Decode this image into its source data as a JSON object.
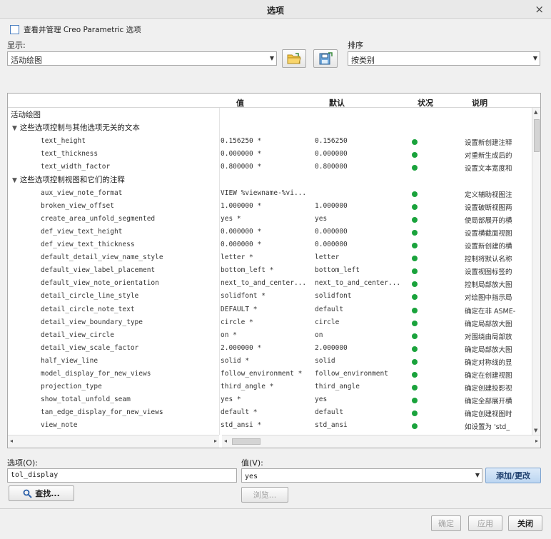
{
  "window": {
    "title": "选项",
    "close_glyph": "×"
  },
  "manage_checkbox": {
    "label": "查看并管理 Creo Parametric 选项",
    "checked": false
  },
  "display": {
    "label": "显示:",
    "value": "活动绘图"
  },
  "sort": {
    "label": "排序",
    "value": "按类别"
  },
  "table": {
    "headers": {
      "value": "值",
      "default": "默认",
      "status": "状况",
      "description": "说明"
    },
    "root_label": "活动绘图",
    "groups": [
      {
        "label": "这些选项控制与其他选项无关的文本",
        "rows": [
          {
            "name": "text_height",
            "value": "0.156250 *",
            "default": "0.156250",
            "desc": "设置新创建注释"
          },
          {
            "name": "text_thickness",
            "value": "0.000000 *",
            "default": "0.000000",
            "desc": "对重新生成后的"
          },
          {
            "name": "text_width_factor",
            "value": "0.800000 *",
            "default": "0.800000",
            "desc": "设置文本宽度和"
          }
        ]
      },
      {
        "label": "这些选项控制视图和它们的注释",
        "rows": [
          {
            "name": "aux_view_note_format",
            "value": "VIEW %viewname-%vi...",
            "default": "",
            "desc": "定义辅助视图注"
          },
          {
            "name": "broken_view_offset",
            "value": "1.000000 *",
            "default": "1.000000",
            "desc": "设置破断视图两"
          },
          {
            "name": "create_area_unfold_segmented",
            "value": "yes *",
            "default": "yes",
            "desc": "使局部展开的横"
          },
          {
            "name": "def_view_text_height",
            "value": "0.000000 *",
            "default": "0.000000",
            "desc": "设置横截面视图"
          },
          {
            "name": "def_view_text_thickness",
            "value": "0.000000 *",
            "default": "0.000000",
            "desc": "设置新创建的横"
          },
          {
            "name": "default_detail_view_name_style",
            "value": "letter *",
            "default": "letter",
            "desc": "控制将默认名称"
          },
          {
            "name": "default_view_label_placement",
            "value": "bottom_left *",
            "default": "bottom_left",
            "desc": "设置视图标签的"
          },
          {
            "name": "default_view_note_orientation",
            "value": "next_to_and_center...",
            "default": "next_to_and_center...",
            "desc": "控制局部放大图"
          },
          {
            "name": "detail_circle_line_style",
            "value": "solidfont *",
            "default": "solidfont",
            "desc": "对绘图中指示局"
          },
          {
            "name": "detail_circle_note_text",
            "value": "DEFAULT *",
            "default": "default",
            "desc": "确定在非 ASME-"
          },
          {
            "name": "detail_view_boundary_type",
            "value": "circle *",
            "default": "circle",
            "desc": "确定局部放大图"
          },
          {
            "name": "detail_view_circle",
            "value": "on *",
            "default": "on",
            "desc": "对围绕由局部放"
          },
          {
            "name": "detail_view_scale_factor",
            "value": "2.000000 *",
            "default": "2.000000",
            "desc": "确定局部放大图"
          },
          {
            "name": "half_view_line",
            "value": "solid *",
            "default": "solid",
            "desc": "确定对称线的显"
          },
          {
            "name": "model_display_for_new_views",
            "value": "follow_environment *",
            "default": "follow_environment",
            "desc": "确定在创建视图"
          },
          {
            "name": "projection_type",
            "value": "third_angle *",
            "default": "third_angle",
            "desc": "确定创建投影视"
          },
          {
            "name": "show_total_unfold_seam",
            "value": "yes *",
            "default": "yes",
            "desc": "确定全部展开横"
          },
          {
            "name": "tan_edge_display_for_new_views",
            "value": "default *",
            "default": "default",
            "desc": "确定创建视图时"
          },
          {
            "name": "view_note",
            "value": "std_ansi *",
            "default": "std_ansi",
            "desc": "如设置为 'std_"
          }
        ]
      }
    ],
    "status_color": "#1aa33c"
  },
  "option_field": {
    "label": "选项(O):",
    "value": "tol_display"
  },
  "value_field": {
    "label": "值(V):",
    "value": "yes"
  },
  "buttons": {
    "add_change": "添加/更改",
    "find": "查找...",
    "browse": "浏览...",
    "ok": "确定",
    "apply": "应用",
    "close": "关闭"
  },
  "icons": {
    "open": "folder-open-icon",
    "save": "save-config-icon",
    "search": "magnifier-icon"
  }
}
